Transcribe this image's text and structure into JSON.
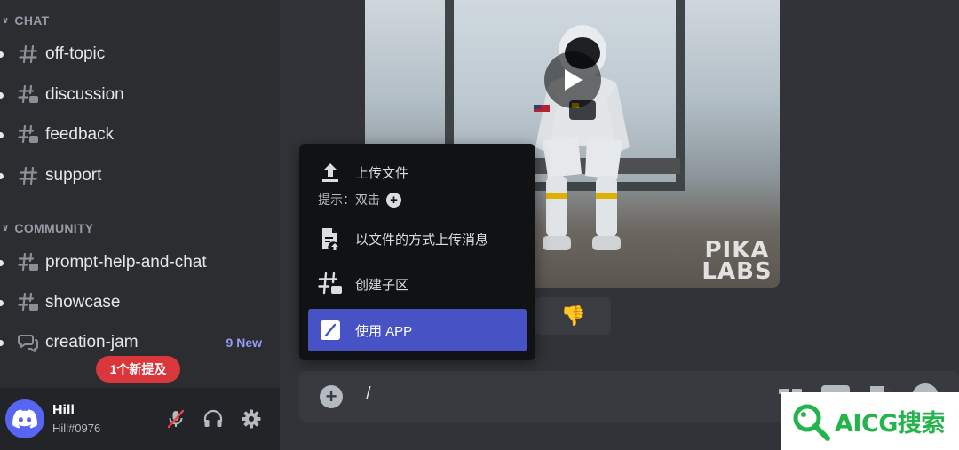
{
  "sidebar": {
    "categories": [
      {
        "label": "CHAT"
      },
      {
        "label": "COMMUNITY"
      }
    ],
    "channels": [
      {
        "name": "off-topic",
        "icon": "text-channel-icon"
      },
      {
        "name": "discussion",
        "icon": "thread-channel-icon"
      },
      {
        "name": "feedback",
        "icon": "thread-channel-icon"
      },
      {
        "name": "support",
        "icon": "text-channel-icon"
      },
      {
        "name": "prompt-help-and-chat",
        "icon": "thread-channel-icon"
      },
      {
        "name": "showcase",
        "icon": "thread-channel-icon"
      },
      {
        "name": "creation-jam",
        "icon": "forum-channel-icon",
        "badge": "9 New"
      }
    ],
    "mention_pill": "1个新提及"
  },
  "user": {
    "name": "Hill",
    "tag": "Hill#0976"
  },
  "message": {
    "watermark": "PIKA LABS",
    "reaction": "👎"
  },
  "composer": {
    "value": "/"
  },
  "attach_menu": {
    "upload_file": "上传文件",
    "hint": "提示：双击",
    "upload_as_file": "以文件的方式上传消息",
    "create_thread": "创建子区",
    "use_app": "使用 APP"
  },
  "badge": {
    "text": "AICG搜索"
  },
  "colors": {
    "sidebar_bg": "#2b2d31",
    "main_bg": "#313338",
    "userbar_bg": "#232428",
    "menu_bg": "#111214",
    "menu_active": "#4752c4",
    "mention_red": "#da373c",
    "new_badge": "#949cf7",
    "brand": "#5865f2",
    "aicg_green": "#25b34b"
  }
}
